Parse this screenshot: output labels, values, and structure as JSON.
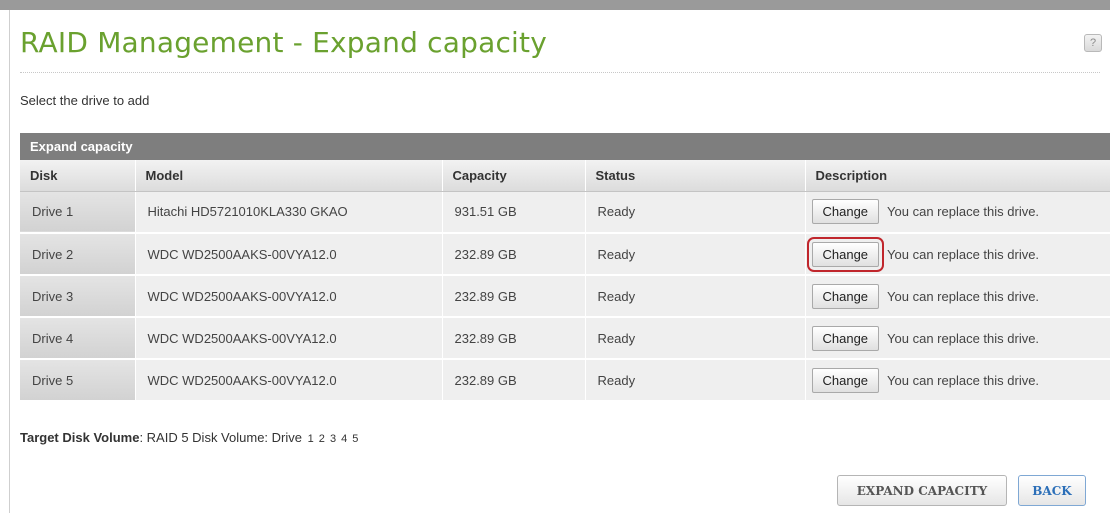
{
  "page": {
    "title": "RAID Management - Expand capacity",
    "subtitle": "Select the drive to add",
    "help_icon": "help-icon"
  },
  "panel": {
    "header": "Expand capacity",
    "columns": [
      "Disk",
      "Model",
      "Capacity",
      "Status",
      "Description"
    ],
    "rows": [
      {
        "disk": "Drive 1",
        "model": "Hitachi HD5721010KLA330 GKAO",
        "capacity": "931.51 GB",
        "status": "Ready",
        "button": "Change",
        "description": "You can replace this drive."
      },
      {
        "disk": "Drive 2",
        "model": "WDC WD2500AAKS-00VYA12.0",
        "capacity": "232.89 GB",
        "status": "Ready",
        "button": "Change",
        "description": "You can replace this drive."
      },
      {
        "disk": "Drive 3",
        "model": "WDC WD2500AAKS-00VYA12.0",
        "capacity": "232.89 GB",
        "status": "Ready",
        "button": "Change",
        "description": "You can replace this drive."
      },
      {
        "disk": "Drive 4",
        "model": "WDC WD2500AAKS-00VYA12.0",
        "capacity": "232.89 GB",
        "status": "Ready",
        "button": "Change",
        "description": "You can replace this drive."
      },
      {
        "disk": "Drive 5",
        "model": "WDC WD2500AAKS-00VYA12.0",
        "capacity": "232.89 GB",
        "status": "Ready",
        "button": "Change",
        "description": "You can replace this drive."
      }
    ]
  },
  "target": {
    "label": "Target Disk Volume",
    "value": ": RAID 5 Disk Volume: Drive",
    "drives": "1 2 3 4 5"
  },
  "buttons": {
    "expand": "EXPAND CAPACITY",
    "back": "BACK"
  },
  "colors": {
    "title": "#6aa12f",
    "panel_header": "#7e7e7e",
    "focus_outline": "#c0262c",
    "back_text": "#2c6fb8"
  }
}
